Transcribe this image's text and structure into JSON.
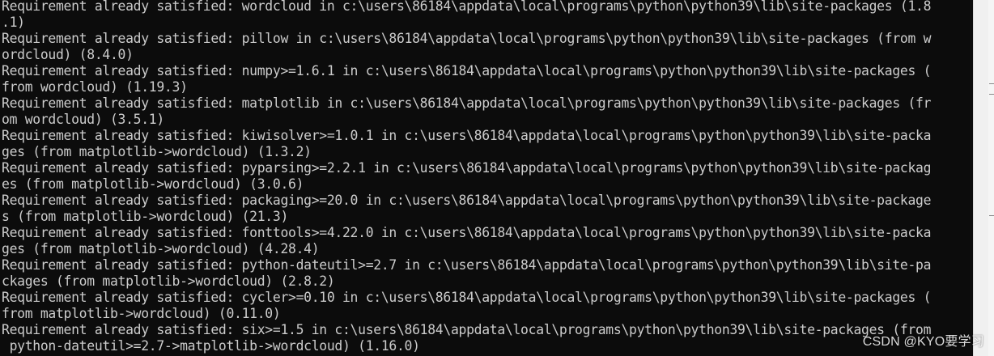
{
  "terminal": {
    "lines": [
      "Requirement already satisfied: wordcloud in c:\\users\\86184\\appdata\\local\\programs\\python\\python39\\lib\\site-packages (1.8",
      ".1)",
      "Requirement already satisfied: pillow in c:\\users\\86184\\appdata\\local\\programs\\python\\python39\\lib\\site-packages (from w",
      "ordcloud) (8.4.0)",
      "Requirement already satisfied: numpy>=1.6.1 in c:\\users\\86184\\appdata\\local\\programs\\python\\python39\\lib\\site-packages (",
      "from wordcloud) (1.19.3)",
      "Requirement already satisfied: matplotlib in c:\\users\\86184\\appdata\\local\\programs\\python\\python39\\lib\\site-packages (fr",
      "om wordcloud) (3.5.1)",
      "Requirement already satisfied: kiwisolver>=1.0.1 in c:\\users\\86184\\appdata\\local\\programs\\python\\python39\\lib\\site-packa",
      "ges (from matplotlib->wordcloud) (1.3.2)",
      "Requirement already satisfied: pyparsing>=2.2.1 in c:\\users\\86184\\appdata\\local\\programs\\python\\python39\\lib\\site-packag",
      "es (from matplotlib->wordcloud) (3.0.6)",
      "Requirement already satisfied: packaging>=20.0 in c:\\users\\86184\\appdata\\local\\programs\\python\\python39\\lib\\site-package",
      "s (from matplotlib->wordcloud) (21.3)",
      "Requirement already satisfied: fonttools>=4.22.0 in c:\\users\\86184\\appdata\\local\\programs\\python\\python39\\lib\\site-packa",
      "ges (from matplotlib->wordcloud) (4.28.4)",
      "Requirement already satisfied: python-dateutil>=2.7 in c:\\users\\86184\\appdata\\local\\programs\\python\\python39\\lib\\site-pa",
      "ckages (from matplotlib->wordcloud) (2.8.2)",
      "Requirement already satisfied: cycler>=0.10 in c:\\users\\86184\\appdata\\local\\programs\\python\\python39\\lib\\site-packages (",
      "from matplotlib->wordcloud) (0.11.0)",
      "Requirement already satisfied: six>=1.5 in c:\\users\\86184\\appdata\\local\\programs\\python\\python39\\lib\\site-packages (from",
      " python-dateutil>=2.7->matplotlib->wordcloud) (1.16.0)"
    ],
    "background_color": "#0c0c0c",
    "text_color": "#cccccc"
  },
  "watermark": {
    "text": "CSDN @KYO要学习"
  }
}
